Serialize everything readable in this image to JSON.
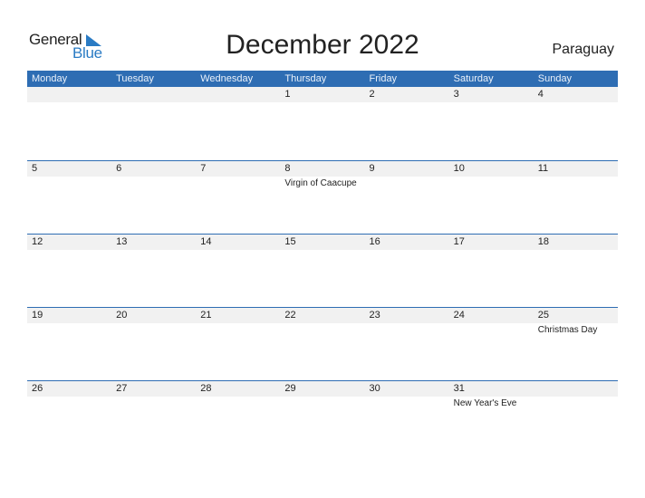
{
  "logo": {
    "line1": "General",
    "line2": "Blue",
    "icon": "triangle-flag-icon",
    "accent": "#2a7bc4"
  },
  "title": "December 2022",
  "country": "Paraguay",
  "colors": {
    "header_bg": "#2e6db3",
    "date_bar": "#f1f1f1"
  },
  "weekdays": [
    "Monday",
    "Tuesday",
    "Wednesday",
    "Thursday",
    "Friday",
    "Saturday",
    "Sunday"
  ],
  "weeks": [
    [
      {
        "day": ""
      },
      {
        "day": ""
      },
      {
        "day": ""
      },
      {
        "day": "1"
      },
      {
        "day": "2"
      },
      {
        "day": "3"
      },
      {
        "day": "4"
      }
    ],
    [
      {
        "day": "5"
      },
      {
        "day": "6"
      },
      {
        "day": "7"
      },
      {
        "day": "8",
        "holiday": "Virgin of Caacupe"
      },
      {
        "day": "9"
      },
      {
        "day": "10"
      },
      {
        "day": "11"
      }
    ],
    [
      {
        "day": "12"
      },
      {
        "day": "13"
      },
      {
        "day": "14"
      },
      {
        "day": "15"
      },
      {
        "day": "16"
      },
      {
        "day": "17"
      },
      {
        "day": "18"
      }
    ],
    [
      {
        "day": "19"
      },
      {
        "day": "20"
      },
      {
        "day": "21"
      },
      {
        "day": "22"
      },
      {
        "day": "23"
      },
      {
        "day": "24"
      },
      {
        "day": "25",
        "holiday": "Christmas Day"
      }
    ],
    [
      {
        "day": "26"
      },
      {
        "day": "27"
      },
      {
        "day": "28"
      },
      {
        "day": "29"
      },
      {
        "day": "30"
      },
      {
        "day": "31",
        "holiday": "New Year's Eve"
      },
      {
        "day": ""
      }
    ]
  ]
}
